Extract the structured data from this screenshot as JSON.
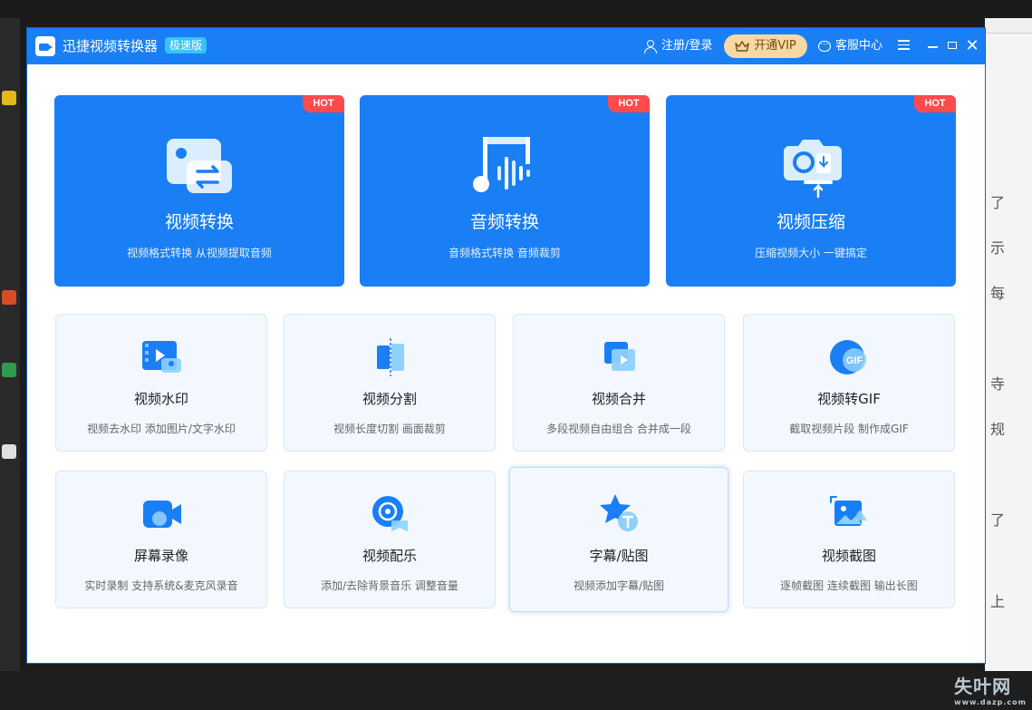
{
  "window": {
    "title": "迅捷视频转换器",
    "edition": "极速版"
  },
  "header": {
    "login_label": "注册/登录",
    "vip_label": "开通VIP",
    "service_label": "客服中心"
  },
  "main_tools": [
    {
      "title": "视频转换",
      "subtitle": "视频格式转换 从视频提取音频",
      "badge": "HOT",
      "icon": "video-convert-icon"
    },
    {
      "title": "音频转换",
      "subtitle": "音频格式转换 音频裁剪",
      "badge": "HOT",
      "icon": "audio-convert-icon"
    },
    {
      "title": "视频压缩",
      "subtitle": "压缩视频大小 一键搞定",
      "badge": "HOT",
      "icon": "video-compress-icon"
    }
  ],
  "tools": [
    {
      "title": "视频水印",
      "subtitle": "视频去水印 添加图片/文字水印",
      "icon": "video-watermark-icon"
    },
    {
      "title": "视频分割",
      "subtitle": "视频长度切割 画面裁剪",
      "icon": "video-split-icon"
    },
    {
      "title": "视频合并",
      "subtitle": "多段视频自由组合 合并成一段",
      "icon": "video-merge-icon"
    },
    {
      "title": "视频转GIF",
      "subtitle": "截取视频片段 制作成GIF",
      "icon": "gif-icon"
    },
    {
      "title": "屏幕录像",
      "subtitle": "实时录制 支持系统&麦克风录音",
      "icon": "screen-record-icon"
    },
    {
      "title": "视频配乐",
      "subtitle": "添加/去除背景音乐 调整音量",
      "icon": "video-music-icon"
    },
    {
      "title": "字幕/贴图",
      "subtitle": "视频添加字幕/贴图",
      "icon": "subtitle-sticker-icon"
    },
    {
      "title": "视频截图",
      "subtitle": "逐帧截图 连续截图 输出长图",
      "icon": "video-screenshot-icon"
    }
  ],
  "watermark": {
    "text": "失叶网",
    "url": "www.dazp.com"
  },
  "colors": {
    "brand_blue": "#1a7ff5",
    "hot_red": "#ff4b4b",
    "vip_gold": "#f7d9a6",
    "card_bg": "#f2f8fe"
  }
}
